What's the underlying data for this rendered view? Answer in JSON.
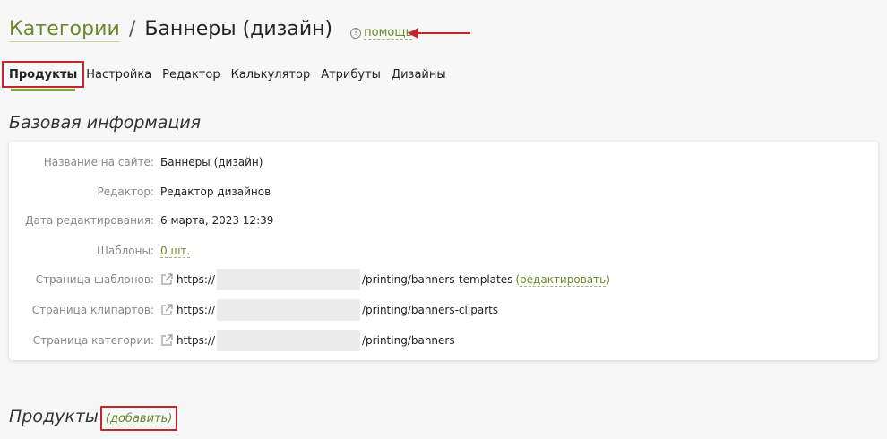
{
  "header": {
    "breadcrumb_root": "Категории",
    "separator": "/",
    "title": "Баннеры (дизайн)",
    "help_label": "помощь"
  },
  "tabs": [
    {
      "label": "Продукты",
      "active": true
    },
    {
      "label": "Настройка",
      "active": false
    },
    {
      "label": "Редактор",
      "active": false
    },
    {
      "label": "Калькулятор",
      "active": false
    },
    {
      "label": "Атрибуты",
      "active": false
    },
    {
      "label": "Дизайны",
      "active": false
    }
  ],
  "base_info": {
    "title": "Базовая информация",
    "rows": [
      {
        "label": "Название на сайте:",
        "value": "Баннеры (дизайн)"
      },
      {
        "label": "Редактор:",
        "value": "Редактор дизайнов"
      },
      {
        "label": "Дата редактирования:",
        "value": "6 марта, 2023 12:39"
      },
      {
        "label": "Шаблоны:",
        "value": "0 шт."
      },
      {
        "label": "Страница шаблонов:",
        "prefix": "https://",
        "suffix": "/printing/banners-templates",
        "edit_label": "редактировать"
      },
      {
        "label": "Страница клипартов:",
        "prefix": "https://",
        "suffix": "/printing/banners-cliparts"
      },
      {
        "label": "Страница категории:",
        "prefix": "https://",
        "suffix": "/printing/banners"
      }
    ]
  },
  "products": {
    "title": "Продукты",
    "add_label": "добавить"
  },
  "colors": {
    "accent": "#6a8a2a",
    "tab_underline": "#7aa533",
    "annotation_red": "#c0262c"
  }
}
